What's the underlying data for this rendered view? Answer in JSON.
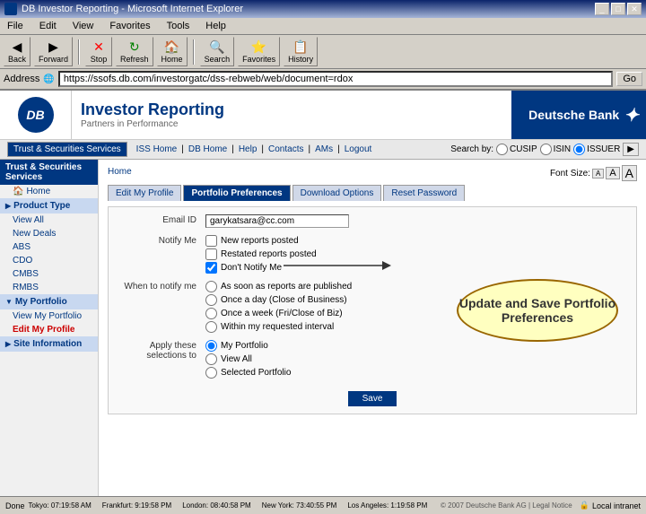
{
  "window": {
    "title": "DB Investor Reporting - Microsoft Internet Explorer"
  },
  "menubar": {
    "items": [
      "File",
      "Edit",
      "View",
      "Favorites",
      "Tools",
      "Help"
    ]
  },
  "toolbar": {
    "back": "Back",
    "forward": "Forward",
    "stop": "Stop",
    "refresh": "Refresh",
    "home": "Home",
    "search": "Search",
    "favorites": "Favorites",
    "history": "History"
  },
  "address": {
    "label": "Address",
    "url": "https://ssofs.db.com/investorgatc/dss-rebweb/web/document=rdox"
  },
  "header": {
    "logo_text": "DB",
    "title": "Investor Reporting",
    "subtitle": "Partners in Performance",
    "bank_name": "Deutsche Bank"
  },
  "top_nav": {
    "links": [
      "ISS Home",
      "DB Home",
      "Help",
      "Contacts",
      "AMs",
      "Logout"
    ],
    "search_label": "Search by:",
    "search_options": [
      "CUSIP",
      "ISIN",
      "ISSUER"
    ]
  },
  "font_size": {
    "label": "Font Size:",
    "small": "A",
    "medium": "A",
    "large": "A"
  },
  "sidebar": {
    "trust_section": "Trust & Securities Services",
    "home_link": "Home",
    "categories": [
      {
        "label": "Product Type",
        "expanded": true
      },
      {
        "label": "View All"
      },
      {
        "label": "New Deals"
      },
      {
        "label": "ABS"
      },
      {
        "label": "CDO"
      },
      {
        "label": "CMBS"
      },
      {
        "label": "RMBS"
      },
      {
        "label": "My Portfolio",
        "group": true
      },
      {
        "label": "View My Portfolio"
      },
      {
        "label": "Edit My Profile",
        "active": true
      },
      {
        "label": "Site Information",
        "expanded": true
      }
    ]
  },
  "breadcrumb": {
    "text": "Home"
  },
  "tabs": [
    {
      "label": "Edit My Profile",
      "active": false
    },
    {
      "label": "Portfolio Preferences",
      "active": true
    },
    {
      "label": "Download Options",
      "active": false
    },
    {
      "label": "Reset Password",
      "active": false
    }
  ],
  "form": {
    "email_label": "Email ID",
    "email_value": "garykatsara@cc.com",
    "notify_label": "Notify Me",
    "notify_options": [
      {
        "label": "New reports posted",
        "checked": false
      },
      {
        "label": "Restated reports posted",
        "checked": false
      },
      {
        "label": "Don't Notify Me",
        "checked": true
      }
    ],
    "when_label": "When to notify me",
    "when_options": [
      {
        "label": "As soon as reports are published",
        "selected": false
      },
      {
        "label": "Once a day (Close of Business)",
        "selected": false
      },
      {
        "label": "Once a week (Fri/Close of Biz)",
        "selected": false
      },
      {
        "label": "Within my requested interval",
        "selected": false
      }
    ],
    "apply_label": "Apply these selections to",
    "apply_options": [
      {
        "label": "My Portfolio",
        "selected": true
      },
      {
        "label": "View All",
        "selected": false
      },
      {
        "label": "Selected Portfolio",
        "selected": false
      }
    ],
    "save_label": "Save"
  },
  "callout": {
    "text": "Update and Save Portfolio Preferences"
  },
  "status_bar": {
    "cities": [
      {
        "name": "Tokyo",
        "time": "07:19:58 AM"
      },
      {
        "name": "Frankfurt",
        "time": "9:19:58 PM"
      },
      {
        "name": "London",
        "time": "08:40:58 PM"
      },
      {
        "name": "New York",
        "time": "73:40:55 PM"
      },
      {
        "name": "Los Angeles",
        "time": "1:19:58 PM"
      }
    ],
    "copyright": "© 2007 Deutsche Bank AG | Legal Notice",
    "done": "Done",
    "zone": "Local intranet"
  }
}
